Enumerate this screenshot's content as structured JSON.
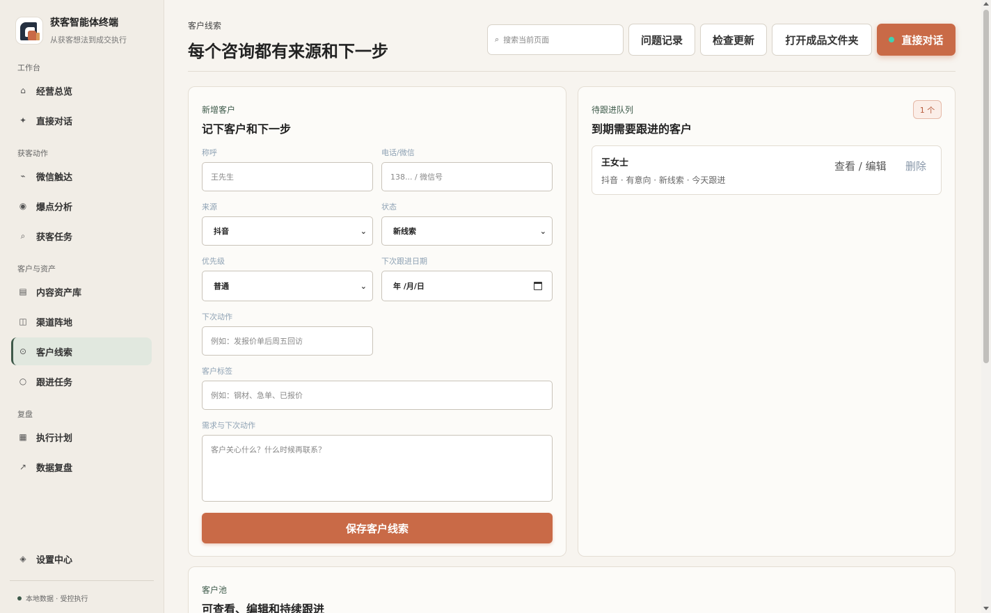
{
  "brand": {
    "title": "获客智能体终端",
    "subtitle": "从获客想法到成交执行"
  },
  "sidebar": {
    "sections": [
      "工作台",
      "获客动作",
      "客户与资产",
      "复盘"
    ],
    "items": [
      {
        "label": "经营总览",
        "icon": "home-icon"
      },
      {
        "label": "直接对话",
        "icon": "sparkle-icon"
      },
      {
        "label": "微信触达",
        "icon": "wave-icon"
      },
      {
        "label": "爆点分析",
        "icon": "target-icon"
      },
      {
        "label": "获客任务",
        "icon": "search-icon"
      },
      {
        "label": "内容资产库",
        "icon": "list-icon"
      },
      {
        "label": "渠道阵地",
        "icon": "columns-icon"
      },
      {
        "label": "客户线索",
        "icon": "dot-circle-icon"
      },
      {
        "label": "跟进任务",
        "icon": "circle-icon"
      },
      {
        "label": "执行计划",
        "icon": "grid-icon"
      },
      {
        "label": "数据复盘",
        "icon": "trend-icon"
      },
      {
        "label": "设置中心",
        "icon": "diamond-icon"
      }
    ],
    "active": "客户线索",
    "footer": "本地数据 · 受控执行"
  },
  "header": {
    "eyebrow": "客户线索",
    "title": "每个咨询都有来源和下一步",
    "search_placeholder": "搜索当前页面",
    "buttons": [
      "问题记录",
      "检查更新",
      "打开成品文件夹",
      "直接对话"
    ]
  },
  "form": {
    "eyebrow": "新增客户",
    "title": "记下客户和下一步",
    "fields": {
      "name": {
        "label": "称呼",
        "placeholder": "王先生"
      },
      "phone": {
        "label": "电话/微信",
        "placeholder": "138... / 微信号"
      },
      "source": {
        "label": "来源",
        "value": "抖音"
      },
      "status": {
        "label": "状态",
        "value": "新线索"
      },
      "priority": {
        "label": "优先级",
        "value": "普通"
      },
      "next_date": {
        "label": "下次跟进日期",
        "value": "年 /月/日"
      },
      "next_action": {
        "label": "下次动作",
        "placeholder": "例如：发报价单后周五回访"
      },
      "tags": {
        "label": "客户标签",
        "placeholder": "例如：钢材、急单、已报价"
      },
      "needs": {
        "label": "需求与下次动作",
        "placeholder": "客户关心什么？什么时候再联系？"
      }
    },
    "submit": "保存客户线索"
  },
  "queue": {
    "eyebrow": "待跟进队列",
    "title": "到期需要跟进的客户",
    "count": "1 个",
    "items": [
      {
        "name": "王女士",
        "meta": "抖音 · 有意向 · 新线索 · 今天跟进",
        "edit": "查看 / 编辑",
        "delete": "删除"
      }
    ]
  },
  "pool": {
    "eyebrow": "客户池",
    "title": "可查看、编辑和持续跟进"
  },
  "colors": {
    "accent": "#c96a47",
    "green": "#3d5a4a",
    "online": "#3fd3b2"
  }
}
